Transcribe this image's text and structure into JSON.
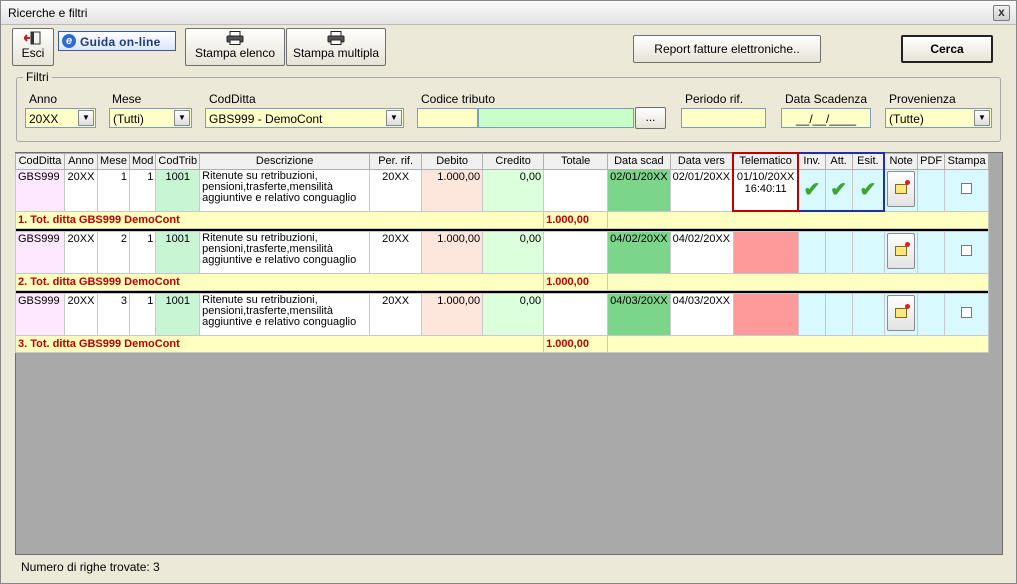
{
  "window": {
    "title": "Ricerche e filtri",
    "close_label": "x"
  },
  "toolbar": {
    "esci": "Esci",
    "guida": "Guida on-line",
    "stampa_elenco": "Stampa elenco",
    "stampa_multipla": "Stampa multipla",
    "report": "Report fatture elettroniche..",
    "cerca": "Cerca"
  },
  "filters": {
    "legend": "Filtri",
    "anno": {
      "label": "Anno",
      "value": "20XX"
    },
    "mese": {
      "label": "Mese",
      "value": "(Tutti)"
    },
    "codditta": {
      "label": "CodDitta",
      "value": "GBS999 - DemoCont"
    },
    "codice_tributo": {
      "label": "Codice tributo",
      "value": "",
      "button": "..."
    },
    "periodo_rif": {
      "label": "Periodo rif.",
      "value": ""
    },
    "data_scadenza": {
      "label": "Data Scadenza",
      "value": "__/__/____"
    },
    "provenienza": {
      "label": "Provenienza",
      "value": "(Tutte)"
    }
  },
  "grid": {
    "columns": [
      "CodDitta",
      "Anno",
      "Mese",
      "Mod",
      "CodTrib",
      "Descrizione",
      "Per. rif.",
      "Debito",
      "Credito",
      "Totale",
      "Data scad",
      "Data vers",
      "Telematico",
      "Inv.",
      "Att.",
      "Esit.",
      "Note",
      "PDF",
      "Stampa"
    ],
    "groups": [
      {
        "row": {
          "codditta": "GBS999",
          "anno": "20XX",
          "mese": "1",
          "mod": "1",
          "codtrib": "1001",
          "descrizione": "Ritenute su retribuzioni, pensioni,trasferte,mensilità aggiuntive e relativo conguaglio",
          "perrif": "20XX",
          "debito": "1.000,00",
          "credito": "0,00",
          "totale": "",
          "datascad": "02/01/20XX",
          "datavers": "02/01/20XX",
          "telematico_date": "01/10/20XX",
          "telematico_time": "16:40:11",
          "inv": "✔",
          "att": "✔",
          "esit": "✔"
        },
        "total": {
          "label": "1. Tot. ditta GBS999 DemoCont",
          "value": "1.000,00"
        }
      },
      {
        "row": {
          "codditta": "GBS999",
          "anno": "20XX",
          "mese": "2",
          "mod": "1",
          "codtrib": "1001",
          "descrizione": "Ritenute su retribuzioni, pensioni,trasferte,mensilità aggiuntive e relativo conguaglio",
          "perrif": "20XX",
          "debito": "1.000,00",
          "credito": "0,00",
          "totale": "",
          "datascad": "04/02/20XX",
          "datavers": "04/02/20XX",
          "telematico_date": "",
          "telematico_time": "",
          "inv": "",
          "att": "",
          "esit": ""
        },
        "total": {
          "label": "2. Tot. ditta GBS999 DemoCont",
          "value": "1.000,00"
        }
      },
      {
        "row": {
          "codditta": "GBS999",
          "anno": "20XX",
          "mese": "3",
          "mod": "1",
          "codtrib": "1001",
          "descrizione": "Ritenute su retribuzioni, pensioni,trasferte,mensilità aggiuntive e relativo conguaglio",
          "perrif": "20XX",
          "debito": "1.000,00",
          "credito": "0,00",
          "totale": "",
          "datascad": "04/03/20XX",
          "datavers": "04/03/20XX",
          "telematico_date": "",
          "telematico_time": "",
          "inv": "",
          "att": "",
          "esit": ""
        },
        "total": {
          "label": "3. Tot. ditta GBS999 DemoCont",
          "value": "1.000,00"
        }
      }
    ]
  },
  "status": {
    "text": "Numero di righe trovate: 3"
  },
  "colors": {
    "highlight_red": "#c00000",
    "highlight_blue": "#1f2fb0"
  }
}
